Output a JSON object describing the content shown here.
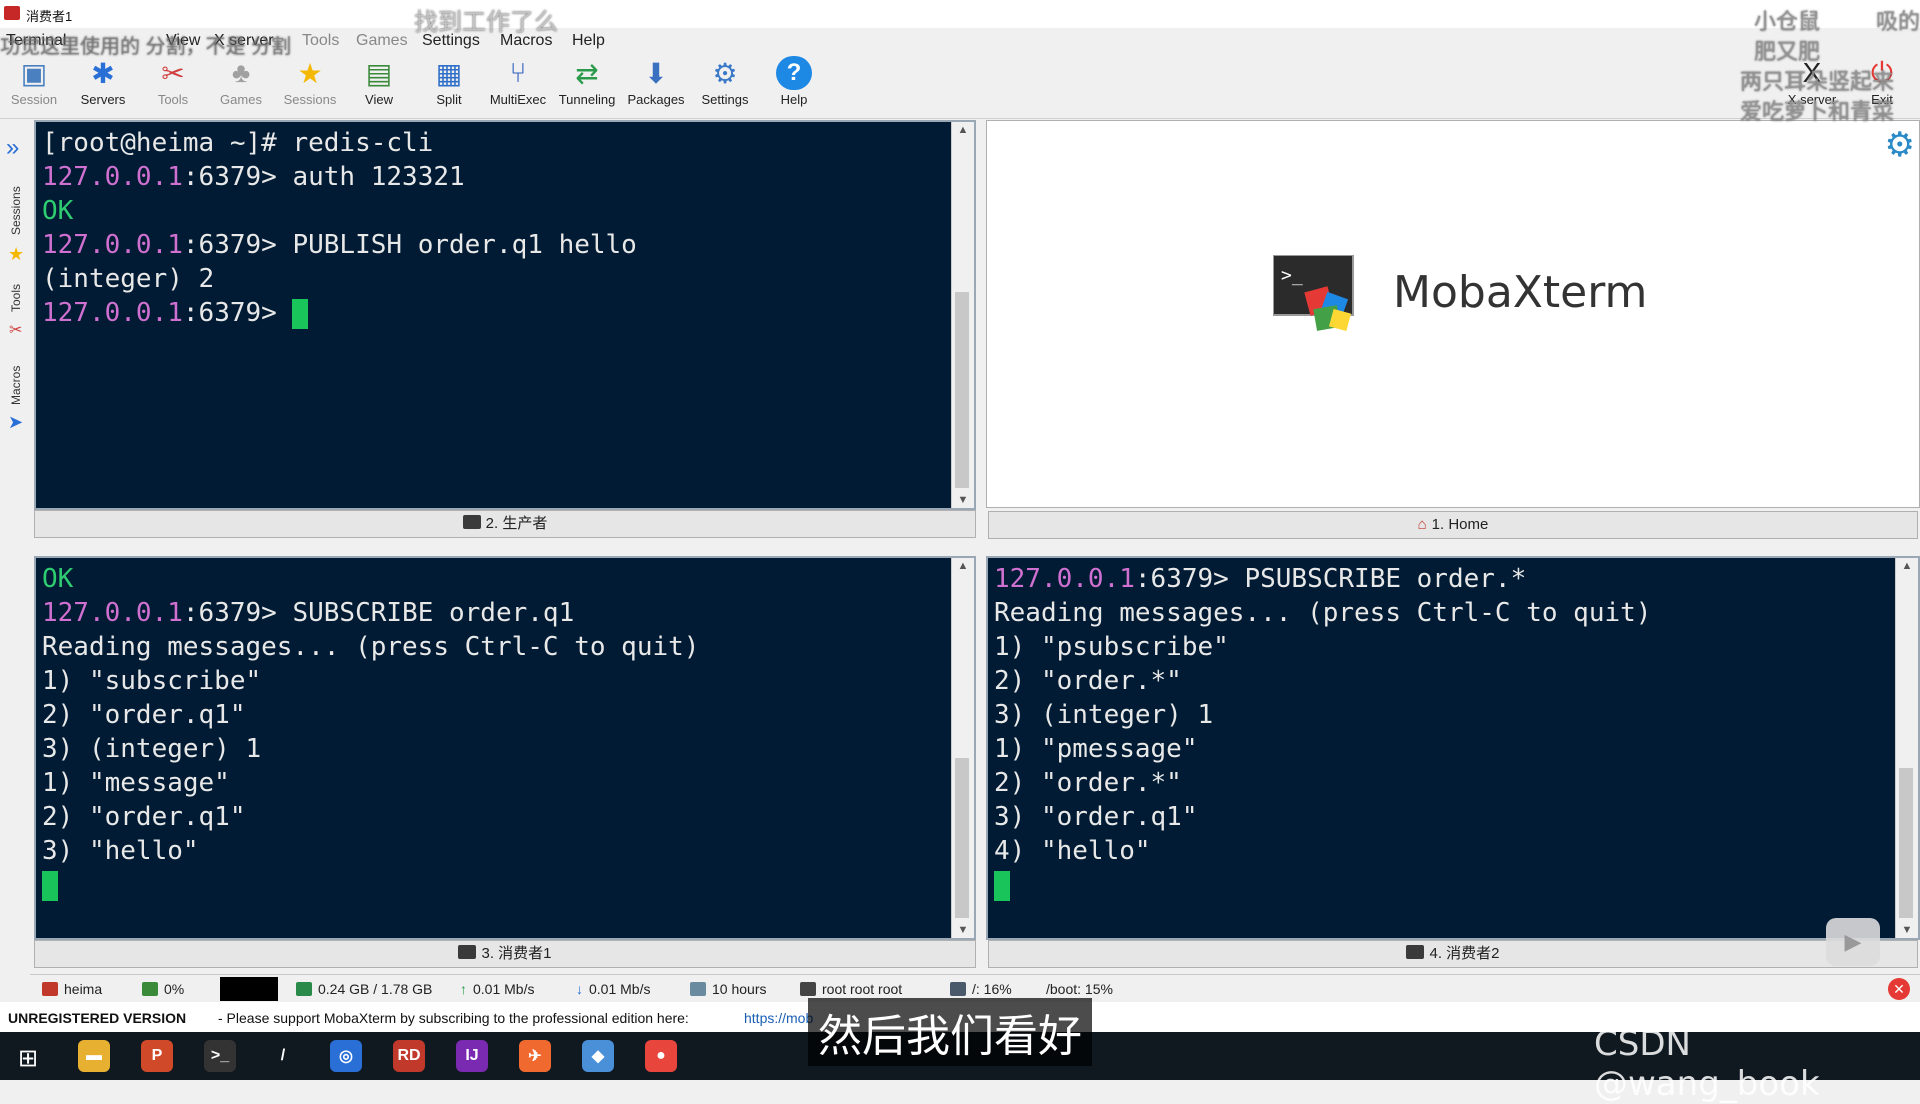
{
  "window": {
    "title": "消费者1"
  },
  "menu": [
    "Terminal",
    "View",
    "X server",
    "Tools",
    "Games",
    "Settings",
    "Macros",
    "Help"
  ],
  "toolbar": {
    "left": [
      {
        "label": "Session",
        "icon": "session-icon",
        "color": "#4a7fc0",
        "dim": true
      },
      {
        "label": "Servers",
        "icon": "servers-icon",
        "color": "#2a6fd6",
        "dim": false
      },
      {
        "label": "Tools",
        "icon": "tools-icon",
        "color": "#d04040",
        "dim": true
      },
      {
        "label": "Games",
        "icon": "games-icon",
        "color": "#a0a0a0",
        "dim": true
      },
      {
        "label": "Sessions",
        "icon": "star-icon",
        "color": "#f5b800",
        "dim": true
      },
      {
        "label": "View",
        "icon": "view-icon",
        "color": "#3a8a3a",
        "dim": false
      },
      {
        "label": "Split",
        "icon": "split-icon",
        "color": "#2f6fc8",
        "dim": false
      },
      {
        "label": "MultiExec",
        "icon": "multiexec-icon",
        "color": "#3060c0",
        "dim": false
      },
      {
        "label": "Tunneling",
        "icon": "tunneling-icon",
        "color": "#2a9a4a",
        "dim": false
      },
      {
        "label": "Packages",
        "icon": "packages-icon",
        "color": "#3a70c0",
        "dim": false
      },
      {
        "label": "Settings",
        "icon": "gear-icon",
        "color": "#3a78c8",
        "dim": false
      },
      {
        "label": "Help",
        "icon": "help-icon",
        "color": "#1e88e5",
        "dim": false
      }
    ],
    "right": [
      {
        "label": "X server",
        "icon": "xserver-icon"
      },
      {
        "label": "Exit",
        "icon": "exit-icon"
      }
    ]
  },
  "sidebar": {
    "tabs": [
      "Sessions",
      "Tools",
      "Macros"
    ]
  },
  "panes": {
    "producer": {
      "tab_label": "2. 生产者",
      "lines": [
        [
          {
            "t": "[root@heima ~]# redis-cli"
          }
        ],
        [
          {
            "t": "127.0.0.1",
            "c": "ip"
          },
          {
            "t": ":6379> auth 123321"
          }
        ],
        [
          {
            "t": "OK",
            "c": "ok"
          }
        ],
        [
          {
            "t": "127.0.0.1",
            "c": "ip"
          },
          {
            "t": ":6379> PUBLISH order.q1 hello"
          }
        ],
        [
          {
            "t": "(integer) 2"
          }
        ],
        [
          {
            "t": "127.0.0.1",
            "c": "ip"
          },
          {
            "t": ":6379> "
          },
          {
            "cursor": true
          }
        ]
      ]
    },
    "home": {
      "tab_label": "1. Home",
      "logo_text": "MobaXterm"
    },
    "consumer1": {
      "tab_label": "3. 消费者1",
      "lines": [
        [
          {
            "t": "OK",
            "c": "ok"
          }
        ],
        [
          {
            "t": "127.0.0.1",
            "c": "ip"
          },
          {
            "t": ":6379> SUBSCRIBE order.q1"
          }
        ],
        [
          {
            "t": "Reading messages... (press Ctrl-C to quit)"
          }
        ],
        [
          {
            "t": "1) \"subscribe\""
          }
        ],
        [
          {
            "t": "2) \"order.q1\""
          }
        ],
        [
          {
            "t": "3) (integer) 1"
          }
        ],
        [
          {
            "t": "1) \"message\""
          }
        ],
        [
          {
            "t": "2) \"order.q1\""
          }
        ],
        [
          {
            "t": "3) \"hello\""
          }
        ],
        [
          {
            "cursor": true
          }
        ]
      ]
    },
    "consumer2": {
      "tab_label": "4. 消费者2",
      "lines": [
        [
          {
            "t": "127.0.0.1",
            "c": "ip"
          },
          {
            "t": ":6379> PSUBSCRIBE order.*"
          }
        ],
        [
          {
            "t": "Reading messages... (press Ctrl-C to quit)"
          }
        ],
        [
          {
            "t": "1) \"psubscribe\""
          }
        ],
        [
          {
            "t": "2) \"order.*\""
          }
        ],
        [
          {
            "t": "3) (integer) 1"
          }
        ],
        [
          {
            "t": "1) \"pmessage\""
          }
        ],
        [
          {
            "t": "2) \"order.*\""
          }
        ],
        [
          {
            "t": "3) \"order.q1\""
          }
        ],
        [
          {
            "t": "4) \"hello\""
          }
        ],
        [
          {
            "cursor": true
          }
        ]
      ]
    }
  },
  "statusbar": {
    "host": "heima",
    "cpu": "0%",
    "memory": "0.24 GB / 1.78 GB",
    "upload": "0.01 Mb/s",
    "download": "0.01 Mb/s",
    "uptime": "10 hours",
    "users": "root  root  root",
    "disk_root": "/: 16%",
    "disk_boot": "/boot: 15%"
  },
  "notice": {
    "bold": "UNREGISTERED VERSION",
    "text": "-  Please support MobaXterm by subscribing to the professional edition here:",
    "link": "https://mob"
  },
  "overlays": {
    "subtitle": "然后我们看好",
    "watermark": "CSDN @wang_book",
    "danmaku": [
      "找到工作了么",
      "功觉这里使用的 分割，不是 分割",
      "小仓鼠",
      "肥又肥",
      "两只耳朵竖起来",
      "爱吃萝卜和青菜",
      "吸的"
    ]
  },
  "taskbar": {
    "apps": [
      {
        "name": "file-explorer-icon",
        "glyph": "▬",
        "bg": "#e8b030"
      },
      {
        "name": "powerpoint-icon",
        "glyph": "P",
        "bg": "#d04a2a"
      },
      {
        "name": "terminal-icon",
        "glyph": ">_",
        "bg": "#333"
      },
      {
        "name": "pen-icon",
        "glyph": "/",
        "bg": "#101820"
      },
      {
        "name": "browser-icon",
        "glyph": "◎",
        "bg": "#2a6fd6"
      },
      {
        "name": "redis-desktop-icon",
        "glyph": "RD",
        "bg": "#c0392b"
      },
      {
        "name": "intellij-icon",
        "glyph": "IJ",
        "bg": "#7a2ab0"
      },
      {
        "name": "postman-icon",
        "glyph": "✈",
        "bg": "#f06a30"
      },
      {
        "name": "mobaxterm-task-icon",
        "glyph": "◆",
        "bg": "#4a90d9"
      },
      {
        "name": "chrome-icon",
        "glyph": "●",
        "bg": "#e8453c"
      }
    ]
  }
}
